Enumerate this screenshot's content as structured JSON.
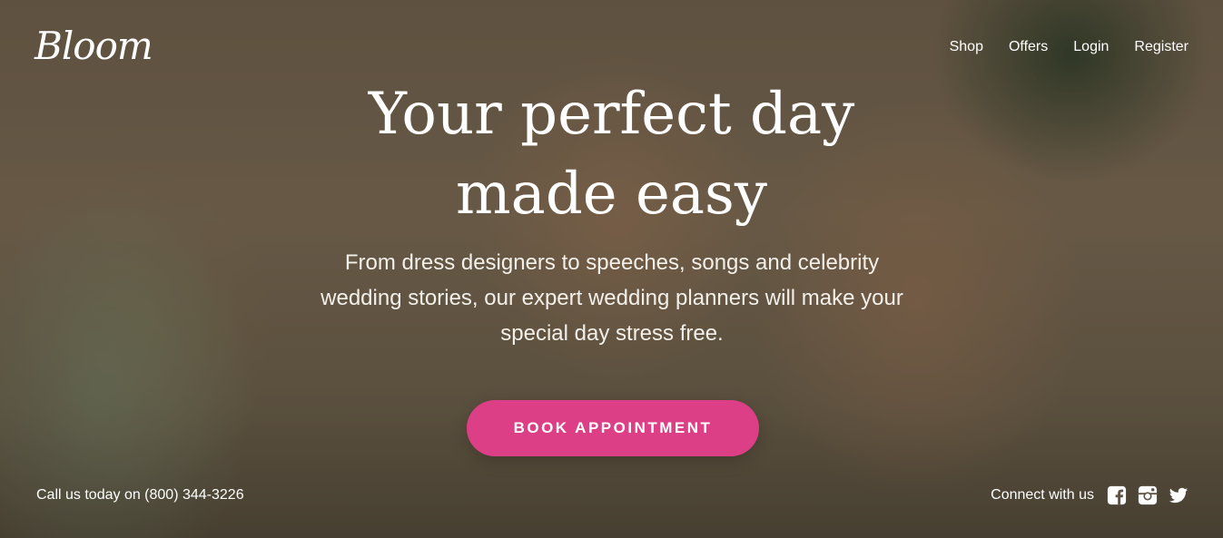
{
  "brand": {
    "logo_text": "Bloom"
  },
  "nav": {
    "items": [
      {
        "label": "Shop"
      },
      {
        "label": "Offers"
      },
      {
        "label": "Login"
      },
      {
        "label": "Register"
      }
    ]
  },
  "hero": {
    "headline_line1": "Your perfect day",
    "headline_line2": "made easy",
    "subhead": "From dress designers to speeches, songs and celebrity wedding stories, our expert wedding planners will make your special day stress free.",
    "cta_label": "BOOK APPOINTMENT"
  },
  "footer": {
    "call_text": "Call us today on (800) 344-3226",
    "connect_label": "Connect with us",
    "social_icons": [
      "facebook-icon",
      "instagram-icon",
      "twitter-icon"
    ]
  },
  "colors": {
    "accent": "#dc3f85",
    "text": "#ffffff"
  }
}
